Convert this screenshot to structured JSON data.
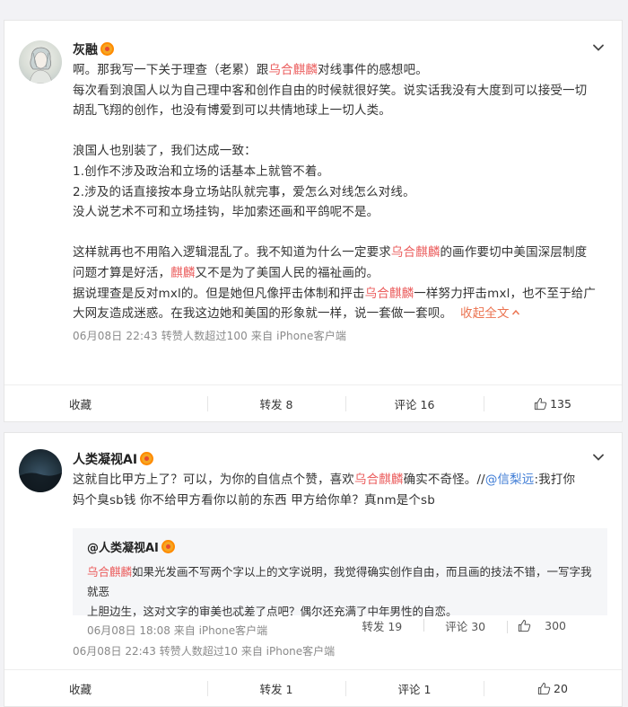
{
  "post1": {
    "username": "灰融",
    "para1": {
      "l1_pre": "啊。那我写一下关于理查（老累）跟",
      "l1_hl": "乌合麒麟",
      "l1_post": "对线事件的感想吧。",
      "l2": "每次看到浪国人以为自己理中客和创作自由的时候就很好笑。说实话我没有大度到可以接受一切",
      "l3": "胡乱飞翔的创作，也没有博爱到可以共情地球上一切人类。"
    },
    "para2": {
      "l1": "浪国人也别装了，我们达成一致：",
      "l2": "1.创作不涉及政治和立场的话基本上就管不着。",
      "l3": "2.涉及的话直接按本身立场站队就完事，爱怎么对线怎么对线。",
      "l4": "没人说艺术不可和立场挂钩，毕加索还画和平鸽呢不是。"
    },
    "para3": {
      "l1_pre": "这样就再也不用陷入逻辑混乱了。我不知道为什么一定要求",
      "l1_hl": "乌合麒麟",
      "l1_post": "的画作要切中美国深层制度",
      "l2_pre": "问题才算是好活，",
      "l2_hl": "麒麟",
      "l2_post": "又不是为了美国人民的福祉画的。",
      "l3_pre": "据说理查是反对mxl的。但是她但凡像抨击体制和抨击",
      "l3_hl": "乌合麒麟",
      "l3_post": "一样努力抨击mxl，也不至于给广",
      "l4": "大网友造成迷惑。在我这边她和美国的形象就一样，说一套做一套呗。",
      "collapse": "收起全文"
    },
    "meta": "06月08日 22:43 转赞人数超过100  来自 iPhone客户端",
    "actions": {
      "fav": "收藏",
      "repost": "转发 8",
      "comment": "评论 16",
      "like": "135"
    }
  },
  "post2": {
    "username": "人类凝视AI",
    "text": {
      "l1_pre": "这就自比甲方上了？可以，为你的自信点个赞，喜欢",
      "l1_hl": "乌合麒麟",
      "l1_mid": "确实不奇怪。//",
      "l1_mention": "@信梨远",
      "l1_post": ":我打你",
      "l2": "妈个臭sb钱 你不给甲方看你以前的东西 甲方给你单？真nm是个sb"
    },
    "quote": {
      "name": "@人类凝视AI",
      "l1_hl": "乌合麒麟",
      "l1_post": "如果光发画不写两个字以上的文字说明，我觉得确实创作自由，而且画的技法不错，一写字我就恶",
      "l2": "上胆边生，这对文字的审美也忒差了点吧？偶尔还充满了中年男性的自恋。",
      "meta": "06月08日 18:08 来自 iPhone客户端",
      "repost": "转发 19",
      "comment": "评论 30",
      "like": "300"
    },
    "meta": "06月08日 22:43 转赞人数超过10  来自 iPhone客户端",
    "actions": {
      "fav": "收藏",
      "repost": "转发 1",
      "comment": "评论 1",
      "like": "20"
    }
  },
  "colors": {
    "highlight": "#eb5d5d",
    "mention": "#3d7bd5",
    "background": "#f2f2f5"
  }
}
